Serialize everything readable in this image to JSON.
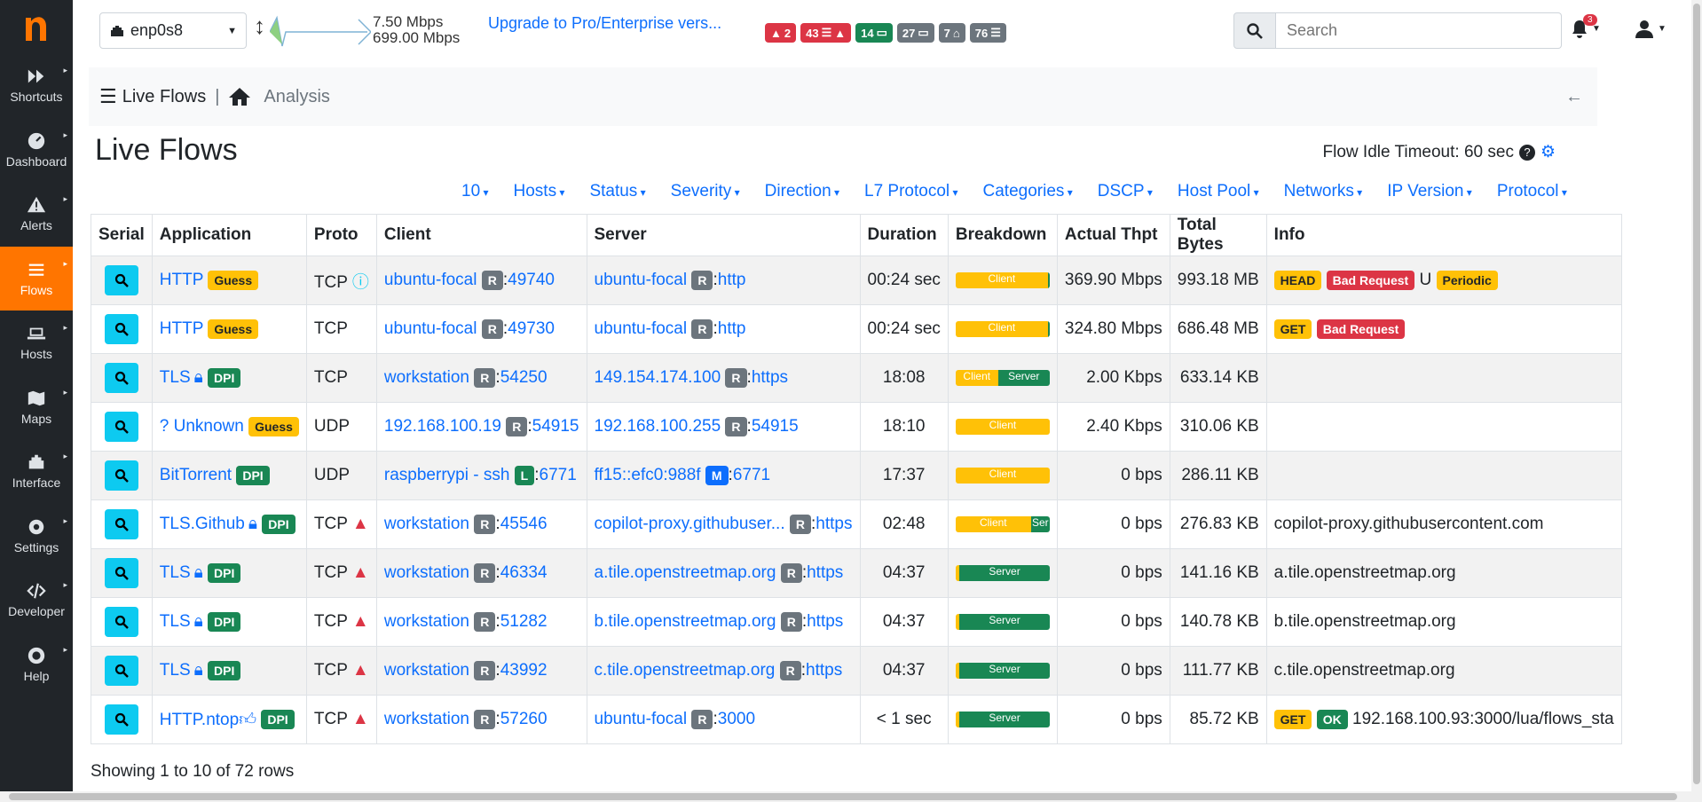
{
  "app": {
    "logo_letter": "n",
    "accent": "#ff7500"
  },
  "sidebar": {
    "items": [
      {
        "label": "Shortcuts",
        "icon": "fast-forward-icon"
      },
      {
        "label": "Dashboard",
        "icon": "gauge-icon"
      },
      {
        "label": "Alerts",
        "icon": "alert-triangle-icon"
      },
      {
        "label": "Flows",
        "icon": "list-icon"
      },
      {
        "label": "Hosts",
        "icon": "laptop-icon"
      },
      {
        "label": "Maps",
        "icon": "map-icon"
      },
      {
        "label": "Interface",
        "icon": "ethernet-icon"
      },
      {
        "label": "Settings",
        "icon": "gear-icon"
      },
      {
        "label": "Developer",
        "icon": "code-icon"
      },
      {
        "label": "Help",
        "icon": "life-ring-icon"
      }
    ],
    "active": "Flows"
  },
  "topbar": {
    "interface": "enp0s8",
    "throughput_up": "7.50 Mbps",
    "throughput_down": "699.00 Mbps",
    "upgrade": "Upgrade to Pro/Enterprise vers...",
    "badges": [
      "2",
      "43",
      "14",
      "27",
      "7",
      "76"
    ],
    "search_placeholder": "Search",
    "notifications": "3"
  },
  "breadcrumb": {
    "section": "Live Flows",
    "separator": "|",
    "page": "Analysis"
  },
  "page": {
    "title": "Live Flows",
    "idle_timeout": "Flow Idle Timeout: 60 sec"
  },
  "filters": [
    "10",
    "Hosts",
    "Status",
    "Severity",
    "Direction",
    "L7 Protocol",
    "Categories",
    "DSCP",
    "Host Pool",
    "Networks",
    "IP Version",
    "Protocol"
  ],
  "table": {
    "headers": [
      "Serial",
      "Application",
      "Proto",
      "Client",
      "Server",
      "Duration",
      "Breakdown",
      "Actual Thpt",
      "Total Bytes",
      "Info"
    ],
    "rows": [
      {
        "app": "HTTP",
        "app_badge": "Guess",
        "proto": "TCP",
        "client": "ubuntu-focal",
        "client_tag": "R",
        "client_port": "49740",
        "server": "ubuntu-focal",
        "server_tag": "R",
        "server_port": "http",
        "duration": "00:24 sec",
        "breakdown_client": "Client",
        "breakdown_server": "",
        "client_pct": 98,
        "thpt": "369.90 Mbps",
        "bytes": "993.18 MB",
        "info_badges": [
          "HEAD",
          "Bad Request"
        ],
        "info_text": "U",
        "info_extra": "Periodic"
      },
      {
        "app": "HTTP",
        "app_badge": "Guess",
        "proto": "TCP",
        "client": "ubuntu-focal",
        "client_tag": "R",
        "client_port": "49730",
        "server": "ubuntu-focal",
        "server_tag": "R",
        "server_port": "http",
        "duration": "00:24 sec",
        "breakdown_client": "Client",
        "breakdown_server": "",
        "client_pct": 98,
        "thpt": "324.80 Mbps",
        "bytes": "686.48 MB",
        "info_badges": [
          "GET",
          "Bad Request"
        ],
        "info_text": "",
        "info_extra": ""
      },
      {
        "app": "TLS",
        "app_badge": "DPI",
        "proto": "TCP",
        "client": "workstation",
        "client_tag": "R",
        "client_port": "54250",
        "server": "149.154.174.100",
        "server_tag": "R",
        "server_port": "https",
        "duration": "18:08",
        "breakdown_client": "Client",
        "breakdown_server": "Server",
        "client_pct": 45,
        "thpt": "2.00 Kbps",
        "bytes": "633.14 KB",
        "info_badges": [],
        "info_text": "",
        "info_extra": ""
      },
      {
        "app": "? Unknown",
        "app_badge": "Guess",
        "proto": "UDP",
        "client": "192.168.100.19",
        "client_tag": "R",
        "client_port": "54915",
        "server": "192.168.100.255",
        "server_tag": "R",
        "server_port": "54915",
        "duration": "18:10",
        "breakdown_client": "Client",
        "breakdown_server": "",
        "client_pct": 100,
        "thpt": "2.40 Kbps",
        "bytes": "310.06 KB",
        "info_badges": [],
        "info_text": "",
        "info_extra": ""
      },
      {
        "app": "BitTorrent",
        "app_badge": "DPI",
        "proto": "UDP",
        "client": "raspberrypi - ssh",
        "client_tag": "L",
        "client_port": "6771",
        "server": "ff15::efc0:988f",
        "server_tag": "M",
        "server_port": "6771",
        "duration": "17:37",
        "breakdown_client": "Client",
        "breakdown_server": "",
        "client_pct": 100,
        "thpt": "0 bps",
        "bytes": "286.11 KB",
        "info_badges": [],
        "info_text": "",
        "info_extra": ""
      },
      {
        "app": "TLS.Github",
        "app_badge": "DPI",
        "proto": "TCP",
        "client": "workstation",
        "client_tag": "R",
        "client_port": "45546",
        "server": "copilot-proxy.githubuser...",
        "server_tag": "R",
        "server_port": "https",
        "duration": "02:48",
        "breakdown_client": "Client",
        "breakdown_server": "Ser",
        "client_pct": 80,
        "thpt": "0 bps",
        "bytes": "276.83 KB",
        "info_badges": [],
        "info_text": "copilot-proxy.githubusercontent.com",
        "info_extra": ""
      },
      {
        "app": "TLS",
        "app_badge": "DPI",
        "proto": "TCP",
        "client": "workstation",
        "client_tag": "R",
        "client_port": "46334",
        "server": "a.tile.openstreetmap.org",
        "server_tag": "R",
        "server_port": "https",
        "duration": "04:37",
        "breakdown_client": "",
        "breakdown_server": "Server",
        "client_pct": 4,
        "thpt": "0 bps",
        "bytes": "141.16 KB",
        "info_badges": [],
        "info_text": "a.tile.openstreetmap.org",
        "info_extra": ""
      },
      {
        "app": "TLS",
        "app_badge": "DPI",
        "proto": "TCP",
        "client": "workstation",
        "client_tag": "R",
        "client_port": "51282",
        "server": "b.tile.openstreetmap.org",
        "server_tag": "R",
        "server_port": "https",
        "duration": "04:37",
        "breakdown_client": "",
        "breakdown_server": "Server",
        "client_pct": 4,
        "thpt": "0 bps",
        "bytes": "140.78 KB",
        "info_badges": [],
        "info_text": "b.tile.openstreetmap.org",
        "info_extra": ""
      },
      {
        "app": "TLS",
        "app_badge": "DPI",
        "proto": "TCP",
        "client": "workstation",
        "client_tag": "R",
        "client_port": "43992",
        "server": "c.tile.openstreetmap.org",
        "server_tag": "R",
        "server_port": "https",
        "duration": "04:37",
        "breakdown_client": "",
        "breakdown_server": "Server",
        "client_pct": 4,
        "thpt": "0 bps",
        "bytes": "111.77 KB",
        "info_badges": [],
        "info_text": "c.tile.openstreetmap.org",
        "info_extra": ""
      },
      {
        "app": "HTTP.ntop",
        "app_badge": "DPI",
        "proto": "TCP",
        "client": "workstation",
        "client_tag": "R",
        "client_port": "57260",
        "server": "ubuntu-focal",
        "server_tag": "R",
        "server_port": "3000",
        "duration": "< 1 sec",
        "breakdown_client": "",
        "breakdown_server": "Server",
        "client_pct": 4,
        "thpt": "0 bps",
        "bytes": "85.72 KB",
        "info_badges": [
          "GET",
          "OK"
        ],
        "info_text": "192.168.100.93:3000/lua/flows_sta",
        "info_extra": ""
      }
    ]
  },
  "footer": "Showing 1 to 10 of 72 rows"
}
